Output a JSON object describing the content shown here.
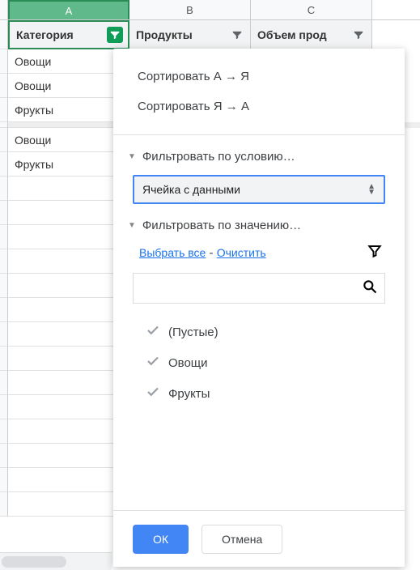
{
  "columns": {
    "a": "A",
    "b": "B",
    "c": "C"
  },
  "headers": {
    "category": "Категория",
    "products": "Продукты",
    "volume": "Объем прод"
  },
  "rows": [
    "Овощи",
    "Овощи",
    "Фрукты",
    "",
    "Овощи",
    "Фрукты",
    "",
    "",
    "",
    "",
    "",
    "",
    "",
    "",
    "",
    "",
    "",
    "",
    ""
  ],
  "popup": {
    "sort_asc": "Сортировать А → Я",
    "sort_desc": "Сортировать Я → А",
    "filter_condition_header": "Фильтровать по условию…",
    "condition_selected": "Ячейка с данными",
    "filter_value_header": "Фильтровать по значению…",
    "select_all": "Выбрать все",
    "separator": " - ",
    "clear": "Очистить",
    "values": [
      "(Пустые)",
      "Овощи",
      "Фрукты"
    ],
    "ok": "ОК",
    "cancel": "Отмена"
  }
}
